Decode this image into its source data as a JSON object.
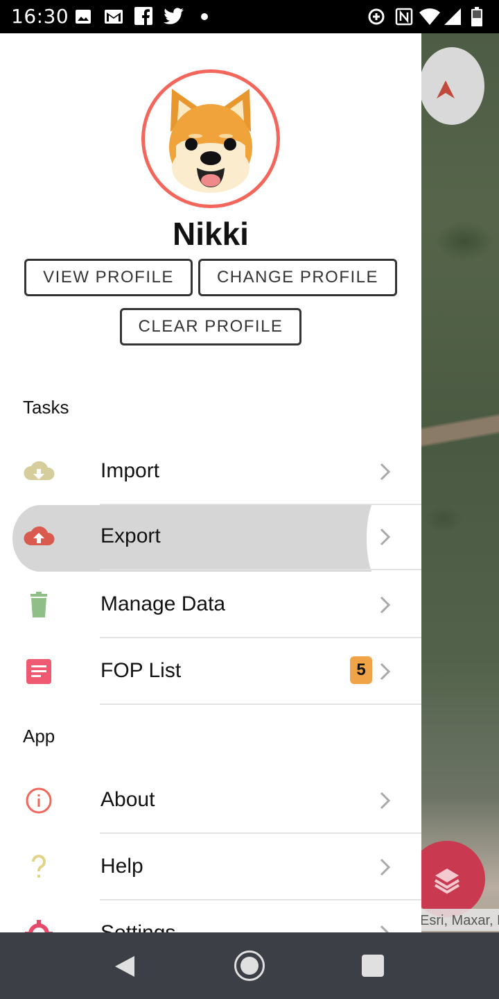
{
  "status_bar": {
    "time": "16:30",
    "icons": [
      "image-icon",
      "gmail-icon",
      "facebook-icon",
      "twitter-icon",
      "dot-icon",
      "data-saver-icon",
      "nfc-icon",
      "wifi-icon",
      "signal-icon",
      "battery-icon"
    ]
  },
  "profile": {
    "name": "Nikki",
    "avatar_icon": "shiba-dog-icon",
    "buttons": {
      "view": "VIEW PROFILE",
      "change": "CHANGE PROFILE",
      "clear": "CLEAR PROFILE"
    }
  },
  "sections": {
    "tasks": "Tasks",
    "app": "App"
  },
  "menu": {
    "import": {
      "label": "Import",
      "icon": "cloud-download-icon",
      "color": "#d5ce9c"
    },
    "export": {
      "label": "Export",
      "icon": "cloud-upload-icon",
      "color": "#d95a4e",
      "active": true
    },
    "manage": {
      "label": "Manage Data",
      "icon": "trash-icon",
      "color": "#8fbf86"
    },
    "fop": {
      "label": "FOP List",
      "icon": "list-document-icon",
      "color": "#ef5a72",
      "badge": "5"
    },
    "about": {
      "label": "About",
      "icon": "info-icon",
      "color": "#f2665c"
    },
    "help": {
      "label": "Help",
      "icon": "question-icon",
      "color": "#e0d48a"
    },
    "settings": {
      "label": "Settings",
      "icon": "gear-icon",
      "color": "#e54a6a"
    }
  },
  "map": {
    "attribution": "Esri, Maxar, Earthstar Geographics, and the GIS User Community, Source: Esri, Cubed, U..."
  },
  "colors": {
    "accent": "#f2665c",
    "highlight": "#d6d6d6",
    "navbar": "#3c3f45",
    "layers_fab": "#c9394f"
  }
}
